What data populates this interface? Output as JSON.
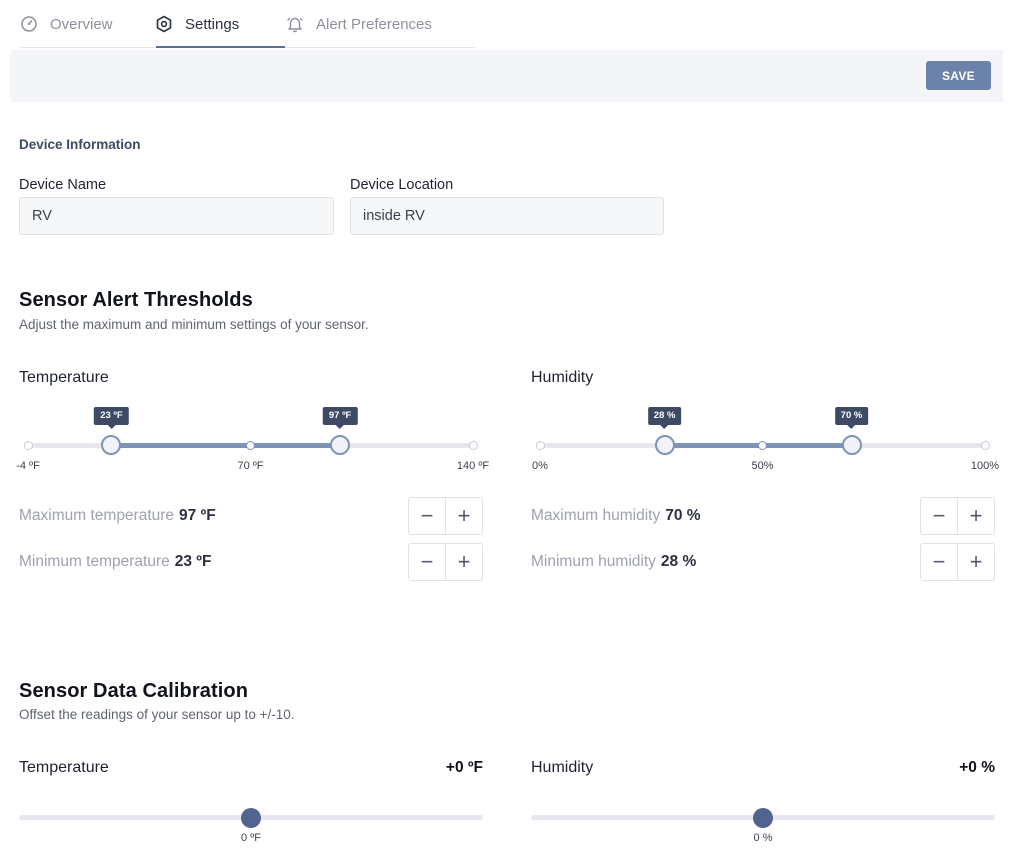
{
  "tabs": [
    {
      "label": "Overview",
      "icon": "gauge-icon",
      "active": false
    },
    {
      "label": "Settings",
      "icon": "settings-hex-icon",
      "active": true
    },
    {
      "label": "Alert Preferences",
      "icon": "bell-icon",
      "active": false
    }
  ],
  "toolbar": {
    "save_label": "SAVE"
  },
  "device_info": {
    "section_title": "Device Information",
    "name_label": "Device Name",
    "name_value": "RV",
    "location_label": "Device Location",
    "location_value": "inside RV"
  },
  "thresholds": {
    "title": "Sensor Alert Thresholds",
    "subtitle": "Adjust the maximum and minimum settings of your sensor.",
    "temperature": {
      "title": "Temperature",
      "min_limit": -4,
      "max_limit": 140,
      "low": 23,
      "high": 97,
      "low_tip": "23 ºF",
      "high_tip": "97 ºF",
      "mark_min": "-4 ºF",
      "mark_mid": "70 ºF",
      "mark_max": "140 ºF",
      "max_label": "Maximum temperature",
      "max_value": "97 ºF",
      "min_label": "Minimum temperature",
      "min_value": "23 ºF"
    },
    "humidity": {
      "title": "Humidity",
      "min_limit": 0,
      "max_limit": 100,
      "low": 28,
      "high": 70,
      "low_tip": "28 %",
      "high_tip": "70 %",
      "mark_min": "0%",
      "mark_mid": "50%",
      "mark_max": "100%",
      "max_label": "Maximum humidity",
      "max_value": "70 %",
      "min_label": "Minimum humidity",
      "min_value": "28 %"
    }
  },
  "calibration": {
    "title": "Sensor Data Calibration",
    "subtitle": "Offset the readings of your sensor up to +/-10.",
    "temperature": {
      "title": "Temperature",
      "value": "+0 ºF",
      "offset": 0,
      "range": [
        -10,
        10
      ],
      "mark": "0 ºF"
    },
    "humidity": {
      "title": "Humidity",
      "value": "+0 %",
      "offset": 0,
      "range": [
        -10,
        10
      ],
      "mark": "0 %"
    }
  },
  "colors": {
    "accent": "#7d94b6",
    "accent_dark": "#3d4a66",
    "save_button": "#6b82ab"
  }
}
